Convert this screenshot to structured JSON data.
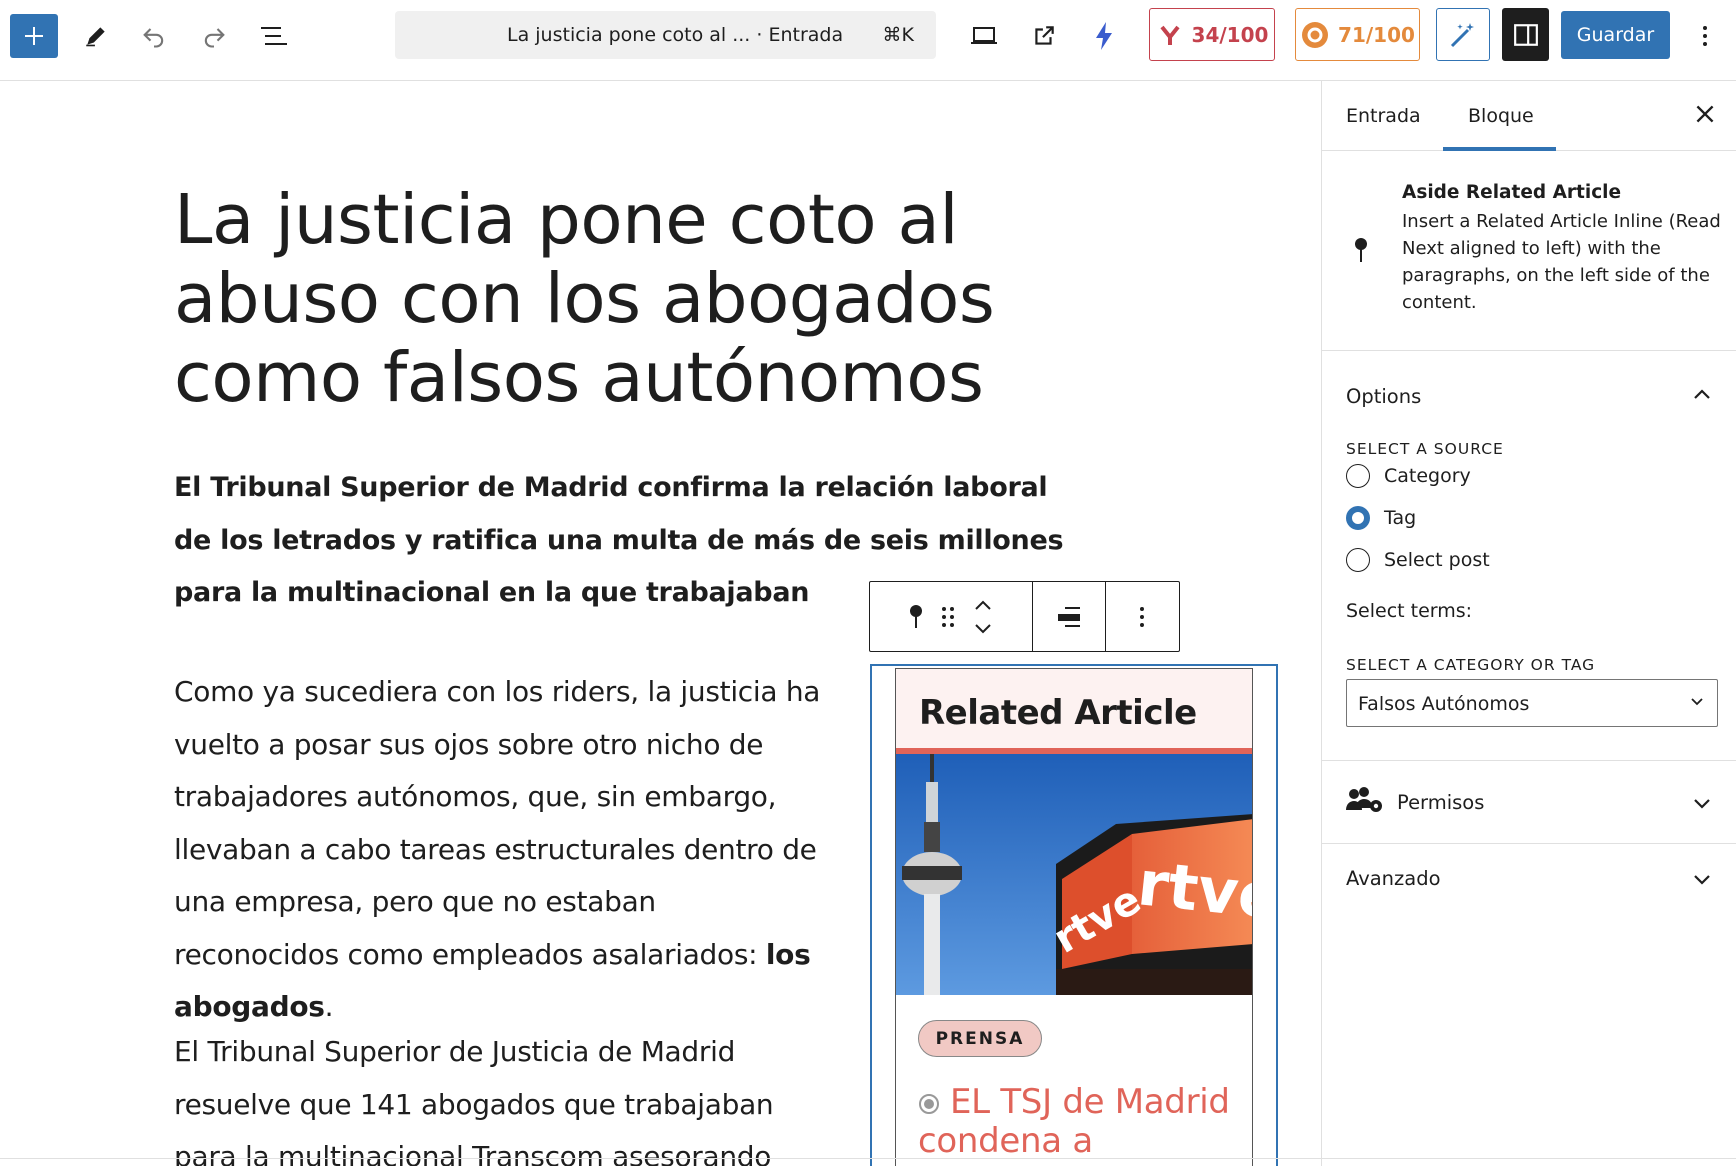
{
  "toolbar": {
    "command_title": "La justicia pone coto al ...",
    "command_type": "· Entrada",
    "command_shortcut": "⌘K",
    "yoast_score": "34/100",
    "seo_score": "71/100",
    "save_label": "Guardar"
  },
  "post": {
    "title": "La justicia pone coto al abuso con los abogados como falsos autónomos",
    "lead": "El Tribunal Superior de Madrid confirma la relación laboral de los letrados y ratifica una multa de más de seis millones para la multinacional en la que trabajaban",
    "p1_text": "Como ya sucediera con los riders, la justicia ha vuelto a posar sus ojos sobre otro nicho de trabajadores autónomos, que, sin embargo, llevaban a cabo tareas estructurales dentro de una empresa, pero que no estaban reconocidos como empleados asalariados: ",
    "p1_bold": "los abogados",
    "p1_end": ".",
    "p2_text": "El Tribunal Superior de Justicia de Madrid resuelve que 141 abogados que trabajaban para la multinacional Transcom asesorando"
  },
  "related": {
    "heading": "Related Article",
    "tag": "PRENSA",
    "link": "EL TSJ de Madrid condena a",
    "image_text": "rtve"
  },
  "sidebar": {
    "tab_post": "Entrada",
    "tab_block": "Bloque",
    "block_name": "Aside Related Article",
    "block_desc": "Insert a Related Article Inline (Read Next aligned to left) with the paragraphs, on the left side of the content.",
    "options_title": "Options",
    "source_label": "SELECT A SOURCE",
    "source_options": [
      "Category",
      "Tag",
      "Select post"
    ],
    "selected_source": "Tag",
    "terms_label": "Select terms:",
    "cat_tag_label": "SELECT A CATEGORY OR TAG",
    "cat_tag_value": "Falsos Autónomos",
    "permisos_title": "Permisos",
    "avanzado_title": "Avanzado"
  },
  "colors": {
    "accent": "#3173b3",
    "yoast": "#c4424d",
    "seo": "#e48a3c",
    "related_accent": "#e06459"
  }
}
